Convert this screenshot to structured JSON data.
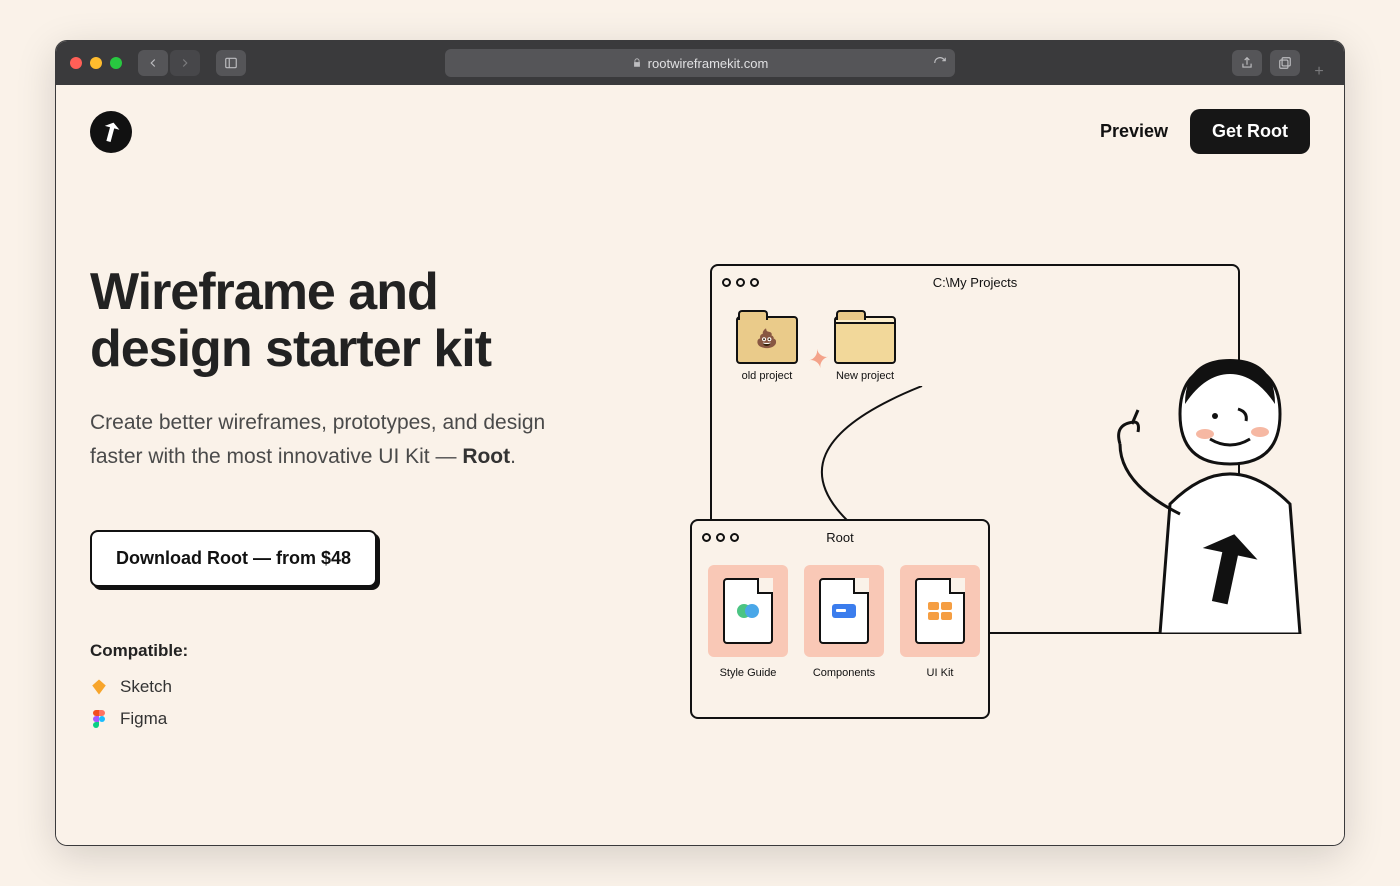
{
  "browser": {
    "url": "rootwireframekit.com"
  },
  "nav": {
    "preview": "Preview",
    "get": "Get Root"
  },
  "hero": {
    "title_line1": "Wireframe and",
    "title_line2": "design starter kit",
    "subtitle_pre": "Create better wireframes, prototypes, and design faster with the most innovative UI Kit — ",
    "subtitle_bold": "Root",
    "subtitle_post": ".",
    "download": "Download Root — from $48"
  },
  "compat": {
    "heading": "Compatible:",
    "items": [
      "Sketch",
      "Figma"
    ]
  },
  "illustration": {
    "window1_title": "C:\\My Projects",
    "folder_old": "old project",
    "folder_new": "New project",
    "window2_title": "Root",
    "files": [
      "Style Guide",
      "Components",
      "UI Kit"
    ]
  }
}
